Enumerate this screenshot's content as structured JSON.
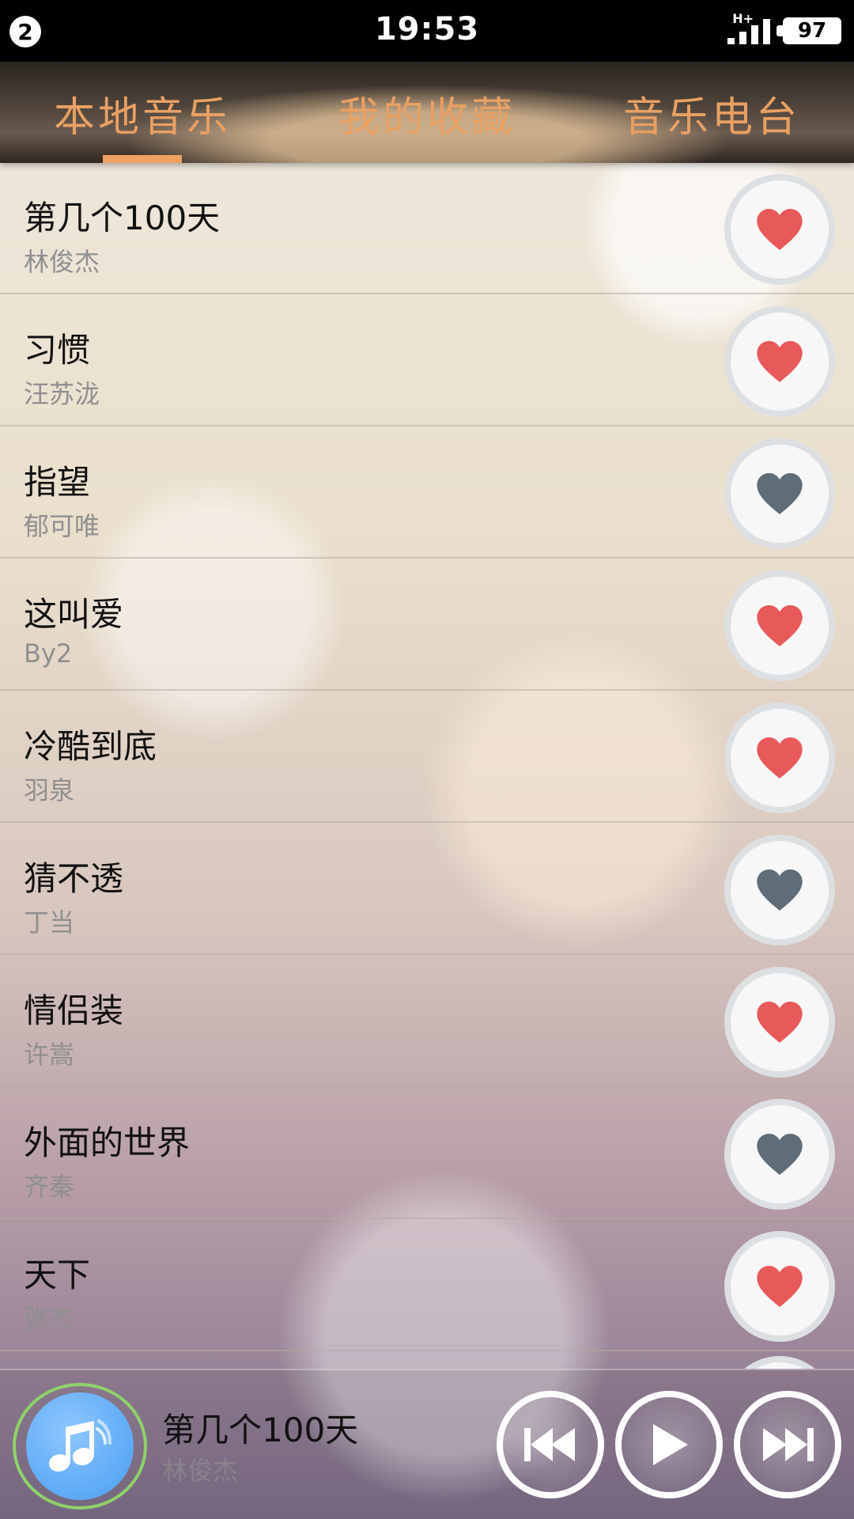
{
  "status_bar": {
    "notification_count": "2",
    "time": "19:53",
    "network": "H+",
    "battery": "97"
  },
  "tabs": [
    {
      "label": "本地音乐",
      "active": true
    },
    {
      "label": "我的收藏",
      "active": false
    },
    {
      "label": "音乐电台",
      "active": false
    }
  ],
  "songs": [
    {
      "title": "第几个100天",
      "artist": "林俊杰",
      "favorited": true
    },
    {
      "title": "习惯",
      "artist": "汪苏泷",
      "favorited": true
    },
    {
      "title": "指望",
      "artist": "郁可唯",
      "favorited": false
    },
    {
      "title": "这叫爱",
      "artist": "By2",
      "favorited": true
    },
    {
      "title": "冷酷到底",
      "artist": "羽泉",
      "favorited": true
    },
    {
      "title": "猜不透",
      "artist": "丁当",
      "favorited": false
    },
    {
      "title": "情侣装",
      "artist": "许嵩",
      "favorited": true
    },
    {
      "title": "外面的世界",
      "artist": "齐秦",
      "favorited": false
    },
    {
      "title": "天下",
      "artist": "张杰",
      "favorited": true
    }
  ],
  "now_playing": {
    "title": "第几个100天",
    "artist": "林俊杰"
  },
  "colors": {
    "tab_text": "#e8a063",
    "heart_on": "#e85a5a",
    "heart_off": "#5e6d78",
    "album_blue": "#63aef7",
    "album_ring": "#8fd16b"
  },
  "icons": {
    "favorite": "heart-icon",
    "album": "music-note-icon",
    "previous": "previous-icon",
    "play": "play-icon",
    "next": "next-icon"
  }
}
